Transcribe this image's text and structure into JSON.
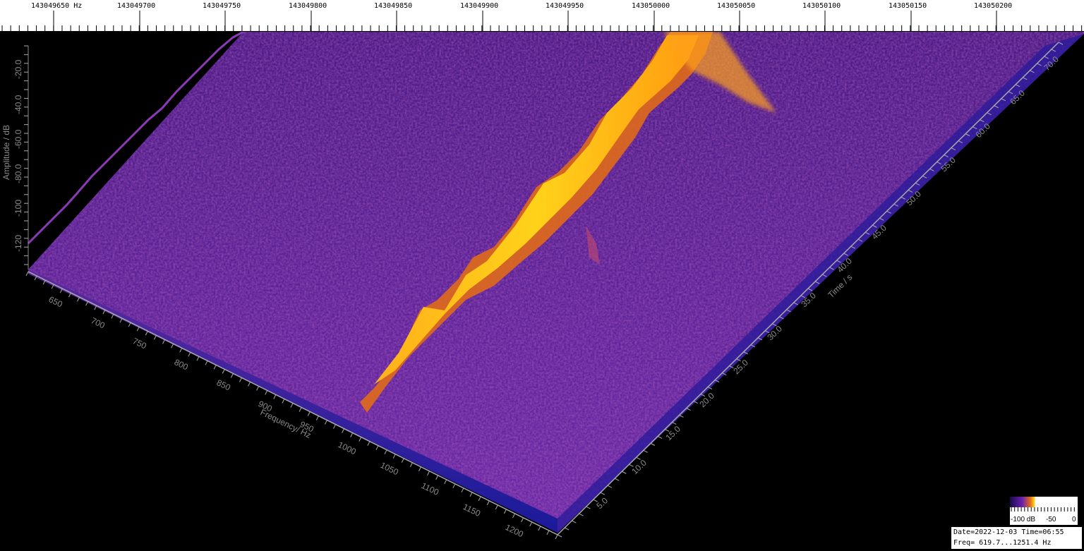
{
  "top_ruler": {
    "labels": [
      "143049650 Hz",
      "143049700",
      "143049750",
      "143049800",
      "143049850",
      "143049900",
      "143049950",
      "143050000",
      "143050050",
      "143050100",
      "143050150",
      "143050200"
    ]
  },
  "amplitude_axis": {
    "title": "Amplitude / dB",
    "ticks": [
      "-20.0",
      "-40.0",
      "-60.0",
      "-80.0",
      "-100",
      "-120"
    ]
  },
  "frequency_axis": {
    "title": "Frequency/ Hz",
    "ticks": [
      "650",
      "700",
      "750",
      "800",
      "850",
      "900",
      "950",
      "1000",
      "1050",
      "1100",
      "1150",
      "1200"
    ]
  },
  "time_axis": {
    "title": "Time / s",
    "ticks": [
      "5.0",
      "10.0",
      "15.0",
      "20.0",
      "25.0",
      "30.0",
      "35.0",
      "40.0",
      "45.0",
      "50.0",
      "55.0",
      "60.0",
      "65.0",
      "70.0"
    ]
  },
  "color_scale": {
    "labels": [
      "-100 dB",
      "-50",
      "0"
    ],
    "colors": [
      "#1a0b4a",
      "#6a1fb0",
      "#e36a1a",
      "#ffd21a"
    ]
  },
  "info": {
    "line1": "Date=2022-12-03 Time=06:55",
    "line2": "Freq= 619.7...1251.4 Hz"
  }
}
